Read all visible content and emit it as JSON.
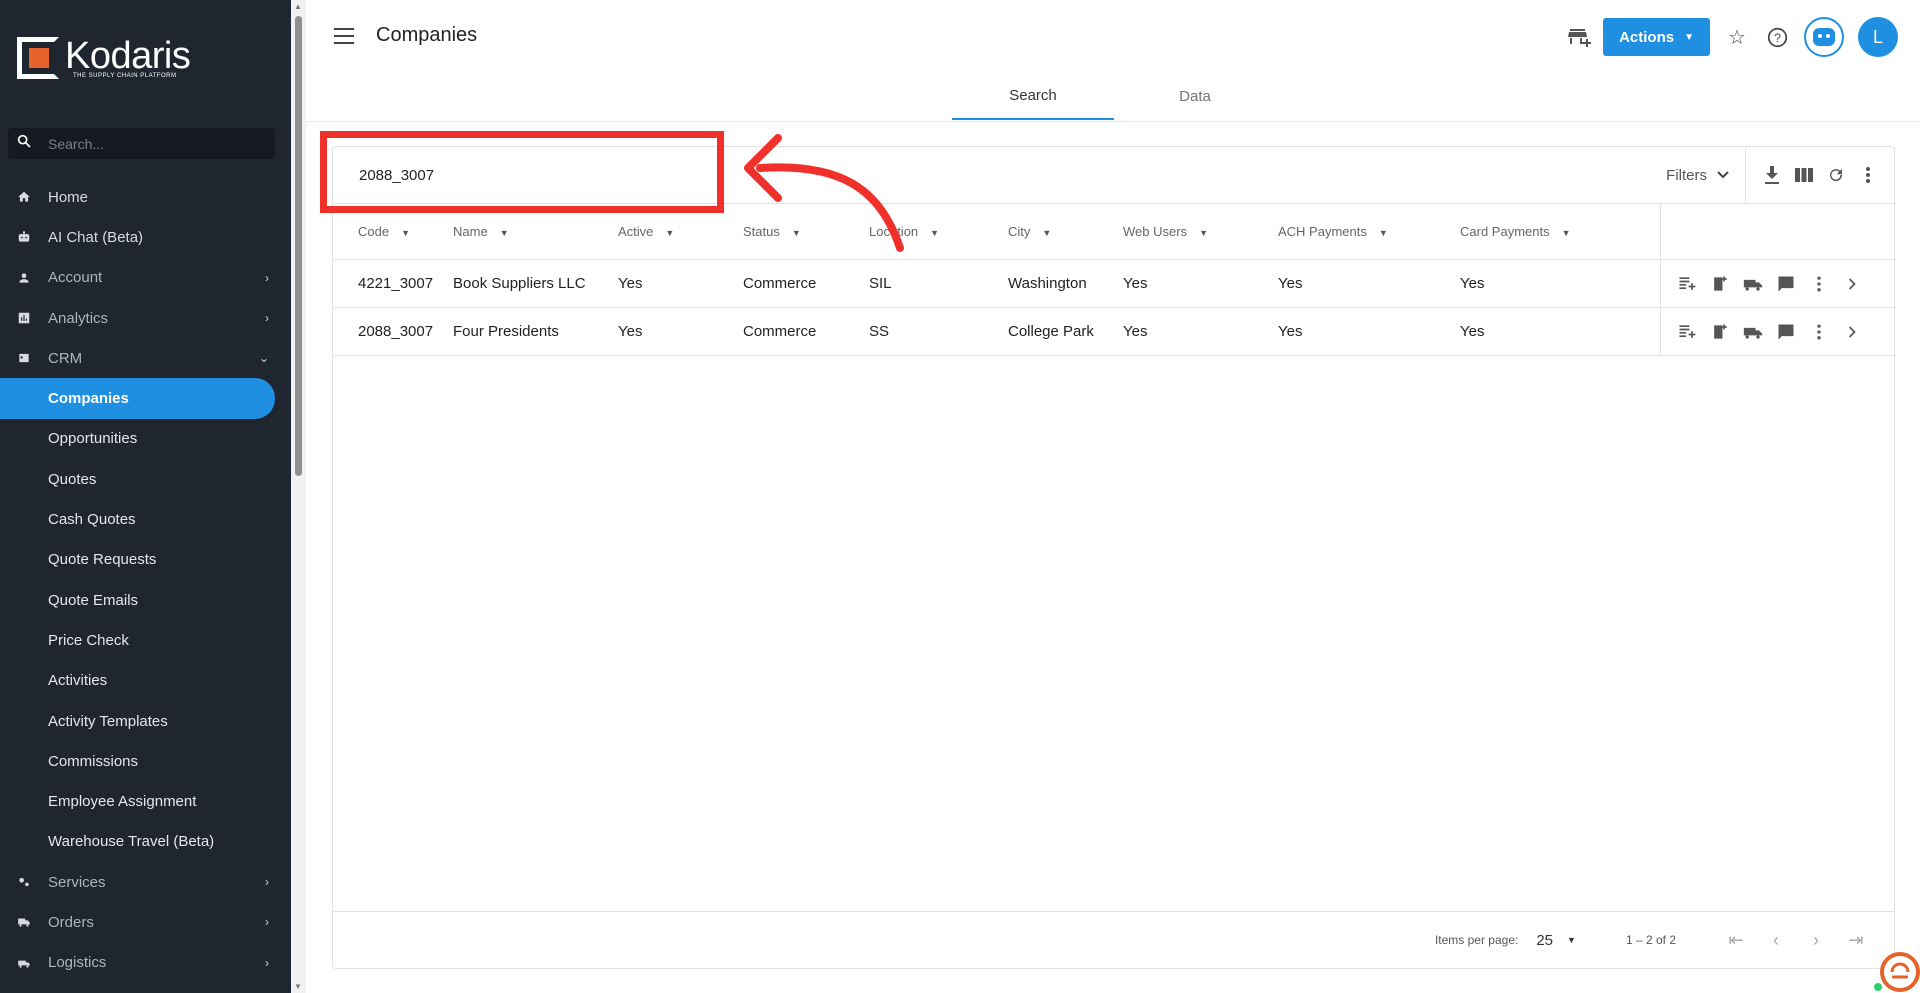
{
  "brand": {
    "name": "Kodaris",
    "tagline": "THE SUPPLY CHAIN PLATFORM"
  },
  "sidebar": {
    "search_placeholder": "Search...",
    "items": [
      {
        "label": "Home",
        "icon": "home-icon"
      },
      {
        "label": "AI Chat (Beta)",
        "icon": "robot-icon"
      },
      {
        "label": "Account",
        "icon": "account-icon",
        "chevron": "›"
      },
      {
        "label": "Analytics",
        "icon": "analytics-icon",
        "chevron": "›"
      },
      {
        "label": "CRM",
        "icon": "crm-icon",
        "chevron": "⌄"
      }
    ],
    "crm_items": [
      "Companies",
      "Opportunities",
      "Quotes",
      "Cash Quotes",
      "Quote Requests",
      "Quote Emails",
      "Price Check",
      "Activities",
      "Activity Templates",
      "Commissions",
      "Employee Assignment",
      "Warehouse Travel (Beta)"
    ],
    "bottom_items": [
      {
        "label": "Services",
        "icon": "services-icon",
        "chevron": "›"
      },
      {
        "label": "Orders",
        "icon": "orders-icon",
        "chevron": "›"
      },
      {
        "label": "Logistics",
        "icon": "logistics-icon",
        "chevron": "›"
      }
    ],
    "active_item": "Companies"
  },
  "header": {
    "title": "Companies",
    "actions_label": "Actions",
    "avatar_initial": "L"
  },
  "tabs": [
    {
      "label": "Search",
      "active": true
    },
    {
      "label": "Data",
      "active": false
    }
  ],
  "search": {
    "value": "2088_3007"
  },
  "toolbar": {
    "filters_label": "Filters"
  },
  "table": {
    "columns": [
      "Code",
      "Name",
      "Active",
      "Status",
      "Location",
      "City",
      "Web Users",
      "ACH Payments",
      "Card Payments"
    ],
    "rows": [
      [
        "4221_3007",
        "Book Suppliers LLC",
        "Yes",
        "Commerce",
        "SIL",
        "Washington",
        "Yes",
        "Yes",
        "Yes"
      ],
      [
        "2088_3007",
        "Four Presidents",
        "Yes",
        "Commerce",
        "SS",
        "College Park",
        "Yes",
        "Yes",
        "Yes"
      ]
    ]
  },
  "paginator": {
    "items_per_page_label": "Items per page:",
    "items_per_page": "25",
    "range": "1 – 2 of 2"
  },
  "colors": {
    "accent": "#1e8fe1",
    "sidebar_bg": "#1f2630",
    "annotation": "#f0302b",
    "brand_orange": "#e5632a"
  }
}
